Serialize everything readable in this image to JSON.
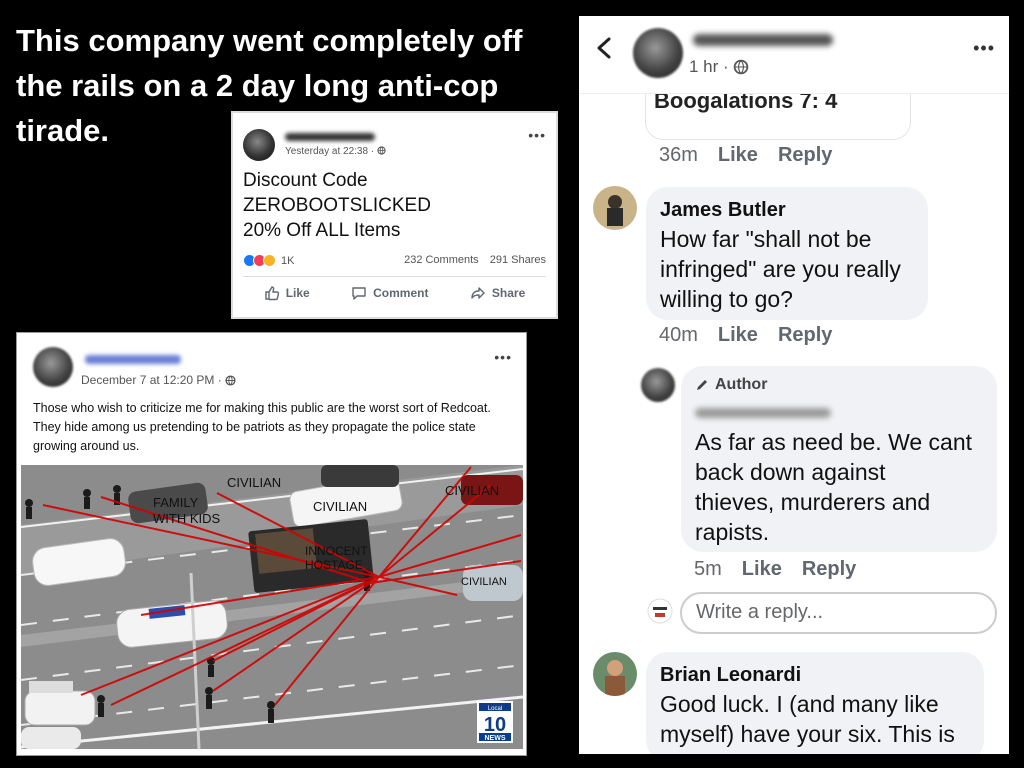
{
  "headline": "This company went completely off the rails on a 2 day long anti-cop tirade.",
  "discount_post": {
    "timestamp": "Yesterday at 22:38 ·",
    "body_lines": [
      "Discount Code",
      "ZEROBOOTSLICKED",
      "20% Off ALL Items"
    ],
    "reactions_count": "1K",
    "comments_count": "232 Comments",
    "shares_count": "291 Shares",
    "like_label": "Like",
    "comment_label": "Comment",
    "share_label": "Share"
  },
  "police_post": {
    "timestamp": "December 7 at 12:20 PM ·",
    "body": "Those who wish to criticize me for making this public are the worst sort of Redcoat. They hide among us pretending to be patriots as they propagate the police state growing around us.",
    "photo_labels": {
      "civilian_1": "CIVILIAN",
      "civilian_2": "CIVILIAN",
      "civilian_3": "CIVILIAN",
      "civilian_4": "CIVILIAN",
      "family_1": "FAMILY",
      "family_2": "WITH KIDS",
      "hostage_1": "INNOCENT",
      "hostage_2": "HOSTAGE",
      "logo_top": "Local",
      "logo_num": "10",
      "logo_bottom": "NEWS"
    }
  },
  "comments_panel": {
    "header_time": "1 hr ·",
    "top_bubble_text": "Boogalations 7: 4",
    "comments": [
      {
        "time": "36m",
        "like": "Like",
        "reply": "Reply"
      },
      {
        "author": "James Butler",
        "lines": [
          "How far \"shall not be",
          "infringed\" are you really",
          "willing to go?"
        ],
        "time": "40m",
        "like": "Like",
        "reply": "Reply"
      },
      {
        "author_tag": "Author",
        "lines": [
          "As far as need be. We cant",
          "back down against",
          "thieves, murderers and",
          "rapists."
        ],
        "time": "5m",
        "like": "Like",
        "reply": "Reply"
      },
      {
        "author": "Brian Leonardi",
        "lines": [
          "Good luck. I (and many like",
          "myself) have your six. This is"
        ]
      }
    ],
    "reply_placeholder": "Write a reply..."
  }
}
